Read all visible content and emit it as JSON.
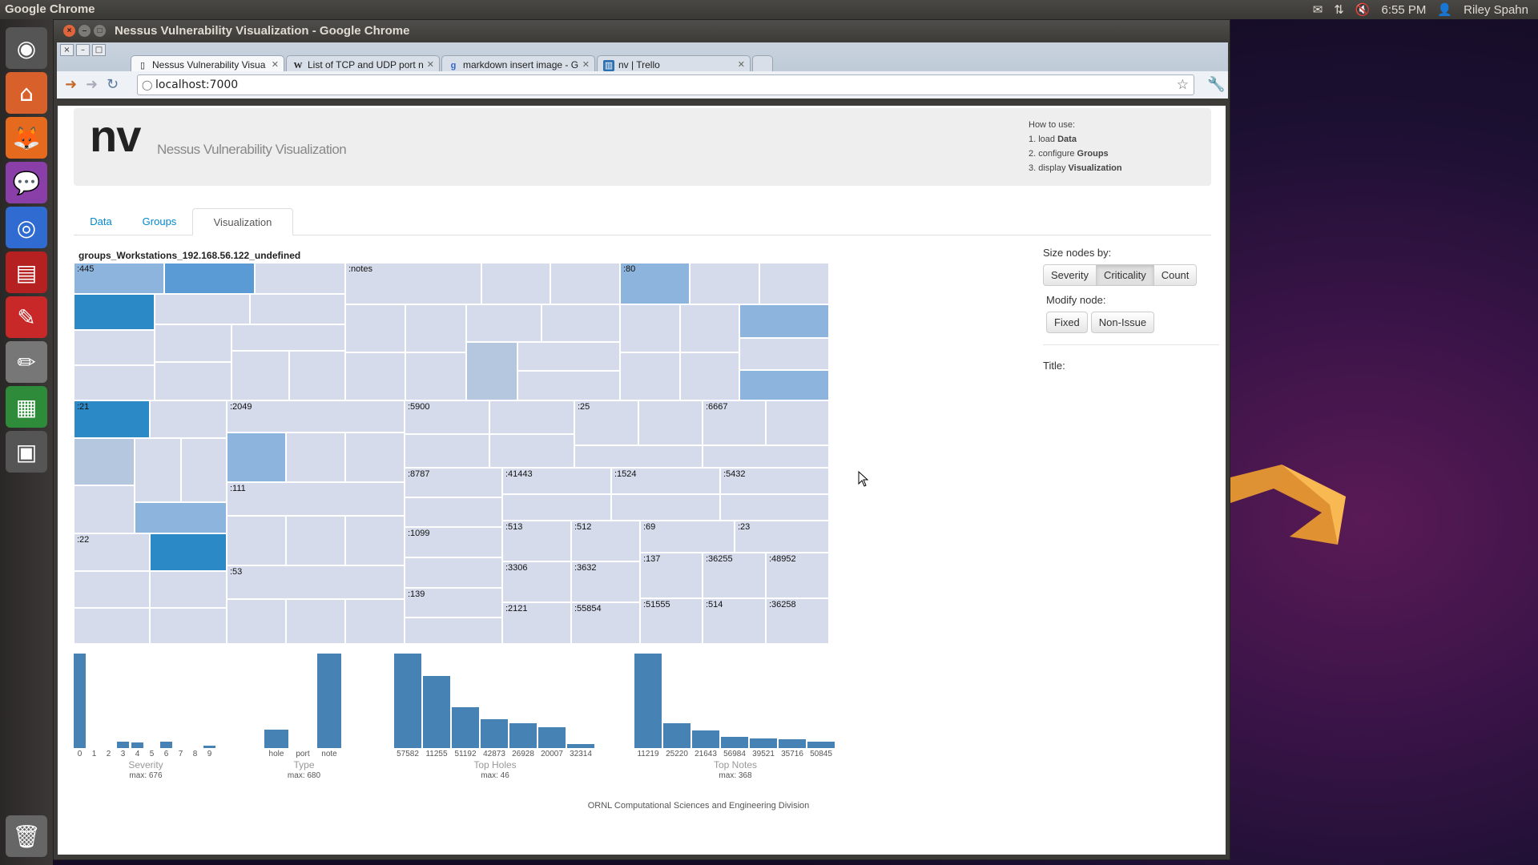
{
  "topbar": {
    "app_name": "Google Chrome",
    "time": "6:55 PM",
    "user": "Riley Spahn"
  },
  "window": {
    "title": "Nessus Vulnerability Visualization - Google Chrome"
  },
  "browser_tabs": [
    {
      "label": "Nessus Vulnerability Visua",
      "icon": "page-icon",
      "active": true
    },
    {
      "label": "List of TCP and UDP port n",
      "icon": "wikipedia-icon",
      "active": false
    },
    {
      "label": "markdown insert image - G",
      "icon": "google-icon",
      "active": false
    },
    {
      "label": "nv | Trello",
      "icon": "trello-icon",
      "active": false
    }
  ],
  "address": {
    "url": "localhost:7000"
  },
  "hero": {
    "logo": "nv",
    "subtitle": "Nessus Vulnerability Visualization",
    "howto_title": "How to use:",
    "steps": [
      {
        "prefix": "1. load ",
        "bold": "Data"
      },
      {
        "prefix": "2. configure ",
        "bold": "Groups"
      },
      {
        "prefix": "3. display ",
        "bold": "Visualization"
      }
    ]
  },
  "page_tabs": [
    "Data",
    "Groups",
    "Visualization"
  ],
  "active_tab": "Visualization",
  "treemap": {
    "title": "groups_Workstations_192.168.56.122_undefined",
    "labels": [
      ":445",
      ":notes",
      ":80",
      ":21",
      ":2049",
      ":5900",
      ":25",
      ":6667",
      ":111",
      ":8787",
      ":41443",
      ":1524",
      ":5432",
      ":22",
      ":1099",
      ":513",
      ":512",
      ":69",
      ":23",
      ":137",
      ":36255",
      ":48952",
      ":3306",
      ":3632",
      ":53",
      ":139",
      ":2121",
      ":55854",
      ":51555",
      ":514",
      ":36258"
    ]
  },
  "sidebar": {
    "size_label": "Size nodes by:",
    "size_buttons": [
      "Severity",
      "Criticality",
      "Count"
    ],
    "size_active": "Criticality",
    "modify_label": "Modify node:",
    "modify_buttons": [
      "Fixed",
      "Non-Issue"
    ],
    "title_label": "Title:"
  },
  "chart_data": [
    {
      "type": "bar",
      "title": "Severity",
      "max_label": "max: 676",
      "categories": [
        "0",
        "1",
        "2",
        "3",
        "4",
        "5",
        "6",
        "7",
        "8",
        "9"
      ],
      "values": [
        676,
        0,
        0,
        45,
        40,
        0,
        45,
        0,
        0,
        20
      ]
    },
    {
      "type": "bar",
      "title": "Type",
      "max_label": "max: 680",
      "categories": [
        "hole",
        "port",
        "note"
      ],
      "values": [
        130,
        0,
        680
      ]
    },
    {
      "type": "bar",
      "title": "Top Holes",
      "max_label": "max: 46",
      "categories": [
        "57582",
        "11255",
        "51192",
        "42873",
        "26928",
        "20007",
        "32314"
      ],
      "values": [
        46,
        35,
        20,
        14,
        12,
        10,
        2
      ]
    },
    {
      "type": "bar",
      "title": "Top Notes",
      "max_label": "max: 368",
      "categories": [
        "11219",
        "25220",
        "21643",
        "56984",
        "39521",
        "35716",
        "50845"
      ],
      "values": [
        368,
        98,
        70,
        45,
        38,
        34,
        24
      ]
    }
  ],
  "footer": {
    "text": "ORNL Computational Sciences and Engineering Division"
  }
}
